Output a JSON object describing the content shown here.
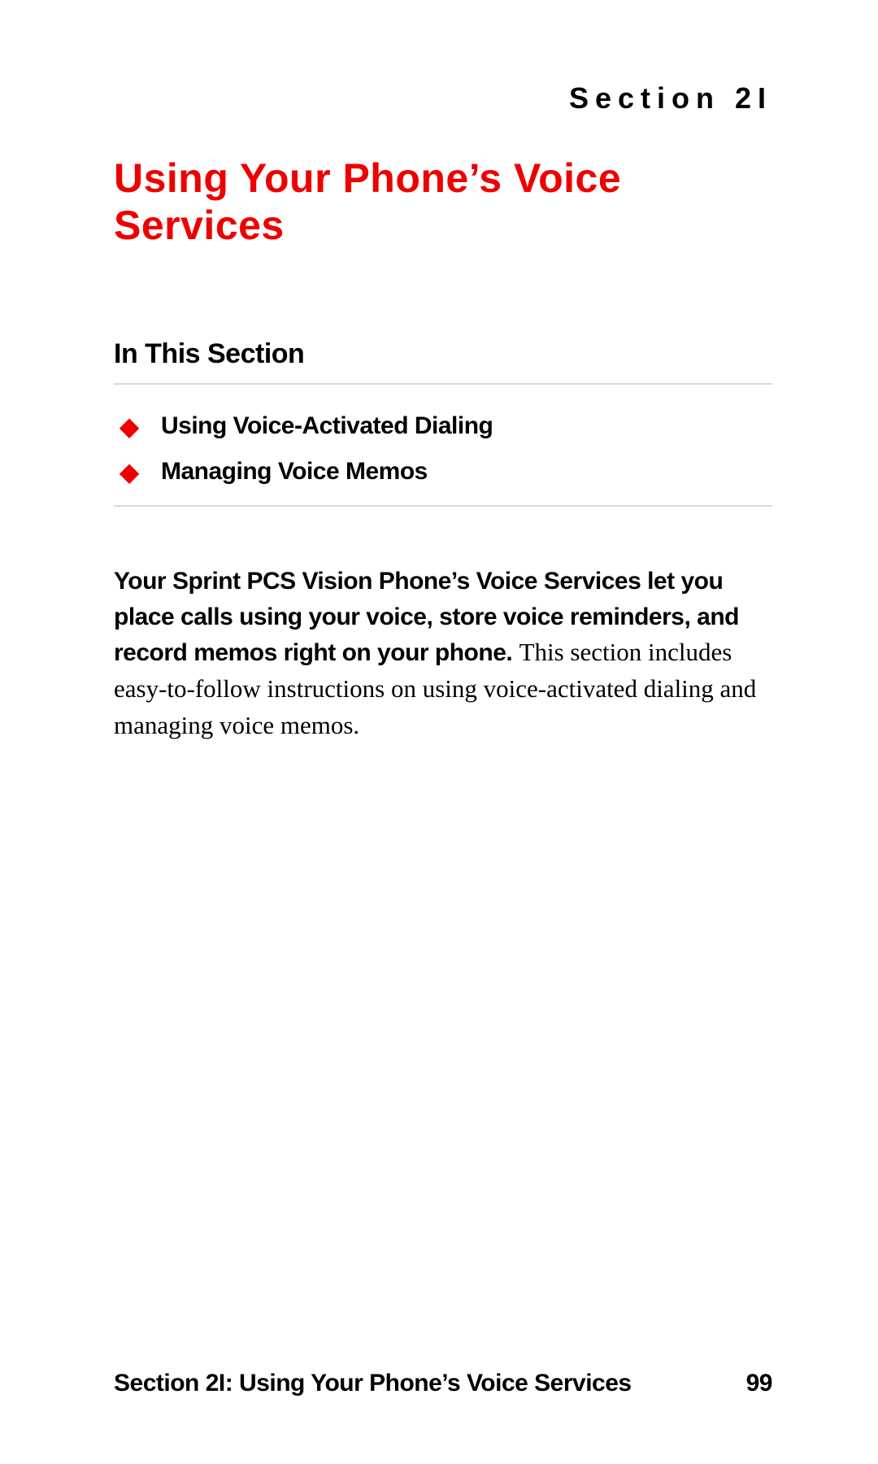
{
  "header": {
    "section_label": "Section 2I"
  },
  "title": "Using Your Phone’s Voice Services",
  "subsection_label": "In This Section",
  "bullets": [
    "Using Voice-Activated Dialing",
    "Managing Voice Memos"
  ],
  "intro": {
    "bold": "Your Sprint PCS Vision Phone’s Voice Services let you place calls using your voice, store voice reminders, and record memos right on your phone.",
    "body": " This section includes easy-to-follow instructions on using voice-activated dialing and managing voice memos."
  },
  "footer": {
    "left": "Section 2I: Using Your Phone’s Voice Services",
    "page_number": "99"
  },
  "colors": {
    "accent": "#ee0000"
  }
}
